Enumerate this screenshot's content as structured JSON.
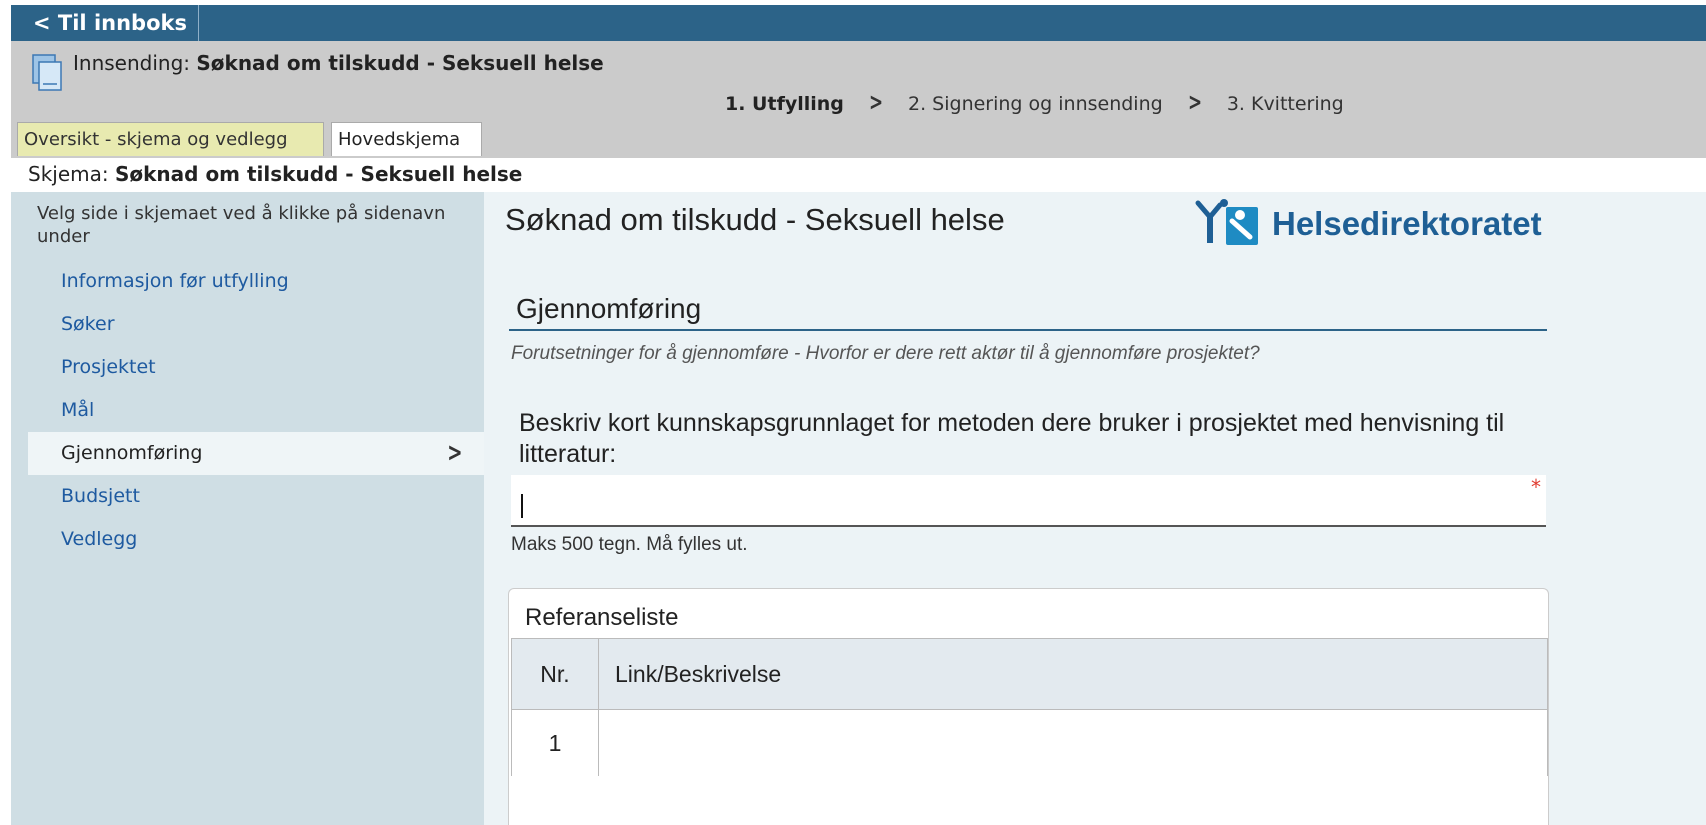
{
  "topbar": {
    "back_label": "< Til innboks"
  },
  "header": {
    "submission_prefix": "Innsending: ",
    "submission_title": "Søknad om tilskudd - Seksuell helse",
    "steps": [
      {
        "label": "1. Utfylling",
        "current": true
      },
      {
        "label": "2. Signering og innsending",
        "current": false
      },
      {
        "label": "3. Kvittering",
        "current": false
      }
    ],
    "tabs": [
      {
        "label": "Oversikt - skjema og vedlegg"
      },
      {
        "label": "Hovedskjema"
      }
    ]
  },
  "schema": {
    "prefix": "Skjema: ",
    "title": "Søknad om tilskudd - Seksuell helse"
  },
  "sidebar": {
    "intro": "Velg side i skjemaet ved å klikke på sidenavn under",
    "items": [
      {
        "label": "Informasjon før utfylling"
      },
      {
        "label": "Søker"
      },
      {
        "label": "Prosjektet"
      },
      {
        "label": "Mål"
      },
      {
        "label": "Gjennomføring",
        "active": true
      },
      {
        "label": "Budsjett"
      },
      {
        "label": "Vedlegg"
      }
    ]
  },
  "main": {
    "form_title": "Søknad om tilskudd - Seksuell helse",
    "logo_text": "Helsedirektoratet",
    "section_title": "Gjennomføring",
    "section_subtitle": "Forutsetninger for å gjennomføre - Hvorfor er dere rett aktør til å gjennomføre prosjektet?",
    "question": "Beskriv kort kunnskapsgrunnlaget for metoden dere bruker i prosjektet med henvisning til litteratur:",
    "input_value": "",
    "required_marker": "*",
    "hint": "Maks 500 tegn. Må fylles ut.",
    "reference": {
      "title": "Referanseliste",
      "columns": [
        "Nr.",
        "Link/Beskrivelse"
      ],
      "rows": [
        {
          "nr": "1",
          "desc": ""
        }
      ]
    }
  },
  "colors": {
    "topbar": "#2c6388",
    "header": "#cbcbcb",
    "sidebar": "#cfdee4",
    "main_bg": "#ecf3f6",
    "link": "#1e5aa0",
    "logo": "#1e5f95"
  }
}
